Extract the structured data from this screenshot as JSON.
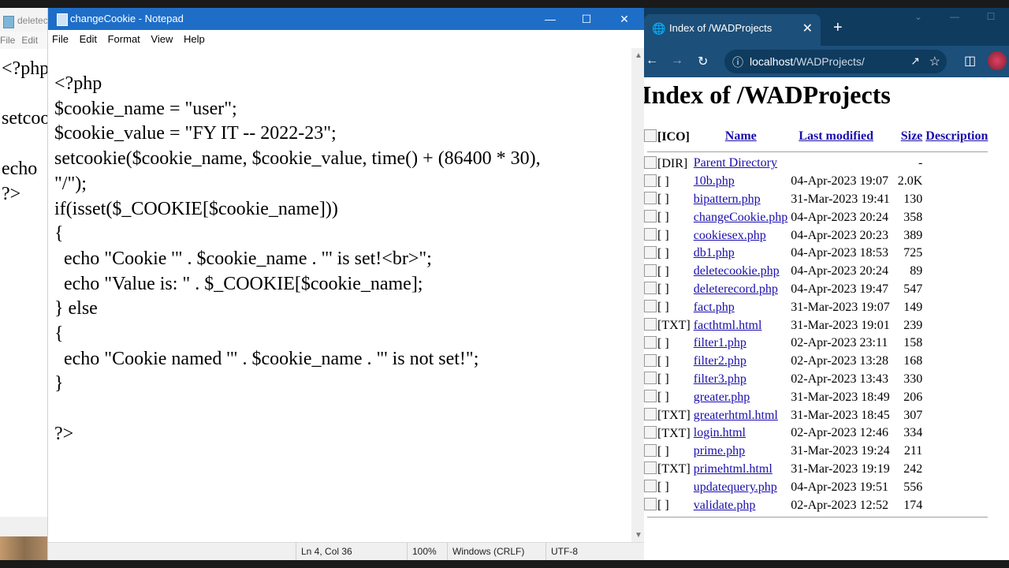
{
  "bg_notepad": {
    "title": "deletec",
    "menu": [
      "File",
      "Edit"
    ],
    "text": "<?php\n\nsetcoo\n\necho\n?>"
  },
  "notepad": {
    "title": "changeCookie - Notepad",
    "menu": [
      "File",
      "Edit",
      "Format",
      "View",
      "Help"
    ],
    "content": "<?php\n$cookie_name = \"user\";\n$cookie_value = \"FY IT -- 2022-23\";\nsetcookie($cookie_name, $cookie_value, time() + (86400 * 30),\n\"/\");\nif(isset($_COOKIE[$cookie_name]))\n{\n  echo \"Cookie '\" . $cookie_name . \"' is set!<br>\";\n  echo \"Value is: \" . $_COOKIE[$cookie_name];\n} else\n{\n  echo \"Cookie named '\" . $cookie_name . \"' is not set!\";\n}\n\n?>",
    "status": {
      "position": "Ln 4, Col 36",
      "zoom": "100%",
      "line_ending": "Windows (CRLF)",
      "encoding": "UTF-8"
    }
  },
  "browser": {
    "tab_title": "Index of /WADProjects",
    "url_host": "localhost",
    "url_path": "/WADProjects/",
    "heading": "Index of /WADProjects",
    "columns": {
      "icon": "[ICO]",
      "name": "Name",
      "modified": "Last modified",
      "size": "Size",
      "description": "Description"
    },
    "parent": {
      "icon": "[DIR]",
      "name": "Parent Directory",
      "size": "-"
    },
    "files": [
      {
        "icon": "[ ]",
        "name": "10b.php",
        "modified": "04-Apr-2023 19:07",
        "size": "2.0K"
      },
      {
        "icon": "[ ]",
        "name": "bipattern.php",
        "modified": "31-Mar-2023 19:41",
        "size": "130"
      },
      {
        "icon": "[ ]",
        "name": "changeCookie.php",
        "modified": "04-Apr-2023 20:24",
        "size": "358"
      },
      {
        "icon": "[ ]",
        "name": "cookiesex.php",
        "modified": "04-Apr-2023 20:23",
        "size": "389"
      },
      {
        "icon": "[ ]",
        "name": "db1.php",
        "modified": "04-Apr-2023 18:53",
        "size": "725"
      },
      {
        "icon": "[ ]",
        "name": "deletecookie.php",
        "modified": "04-Apr-2023 20:24",
        "size": "89"
      },
      {
        "icon": "[ ]",
        "name": "deleterecord.php",
        "modified": "04-Apr-2023 19:47",
        "size": "547"
      },
      {
        "icon": "[ ]",
        "name": "fact.php",
        "modified": "31-Mar-2023 19:07",
        "size": "149"
      },
      {
        "icon": "[TXT]",
        "name": "facthtml.html",
        "modified": "31-Mar-2023 19:01",
        "size": "239"
      },
      {
        "icon": "[ ]",
        "name": "filter1.php",
        "modified": "02-Apr-2023 23:11",
        "size": "158"
      },
      {
        "icon": "[ ]",
        "name": "filter2.php",
        "modified": "02-Apr-2023 13:28",
        "size": "168"
      },
      {
        "icon": "[ ]",
        "name": "filter3.php",
        "modified": "02-Apr-2023 13:43",
        "size": "330"
      },
      {
        "icon": "[ ]",
        "name": "greater.php",
        "modified": "31-Mar-2023 18:49",
        "size": "206"
      },
      {
        "icon": "[TXT]",
        "name": "greaterhtml.html",
        "modified": "31-Mar-2023 18:45",
        "size": "307"
      },
      {
        "icon": "[TXT]",
        "name": "login.html",
        "modified": "02-Apr-2023 12:46",
        "size": "334"
      },
      {
        "icon": "[ ]",
        "name": "prime.php",
        "modified": "31-Mar-2023 19:24",
        "size": "211"
      },
      {
        "icon": "[TXT]",
        "name": "primehtml.html",
        "modified": "31-Mar-2023 19:19",
        "size": "242"
      },
      {
        "icon": "[ ]",
        "name": "updatequery.php",
        "modified": "04-Apr-2023 19:51",
        "size": "556"
      },
      {
        "icon": "[ ]",
        "name": "validate.php",
        "modified": "02-Apr-2023 12:52",
        "size": "174"
      }
    ]
  }
}
